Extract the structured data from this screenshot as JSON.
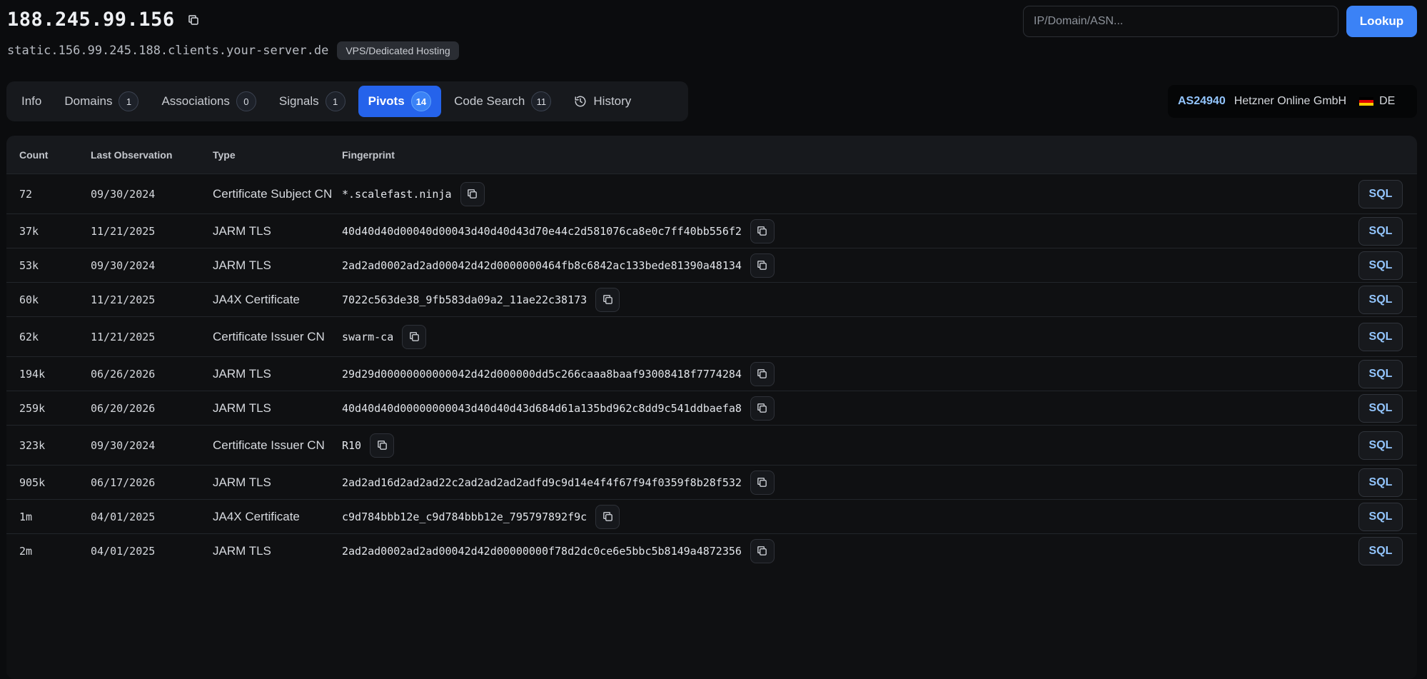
{
  "header": {
    "ip": "188.245.99.156",
    "hostname": "static.156.99.245.188.clients.your-server.de",
    "host_tag": "VPS/Dedicated Hosting"
  },
  "search": {
    "placeholder": "IP/Domain/ASN...",
    "value": "",
    "button_label": "Lookup"
  },
  "tabs": [
    {
      "label": "Info",
      "count": null
    },
    {
      "label": "Domains",
      "count": "1"
    },
    {
      "label": "Associations",
      "count": "0"
    },
    {
      "label": "Signals",
      "count": "1"
    },
    {
      "label": "Pivots",
      "count": "14",
      "active": true
    },
    {
      "label": "Code Search",
      "count": "11"
    },
    {
      "label": "History",
      "icon": "history-icon"
    }
  ],
  "asn_info": {
    "asn": "AS24940",
    "org": "Hetzner Online GmbH",
    "country": "DE",
    "flag_colors": [
      "#000000",
      "#dd0000",
      "#ffce00"
    ]
  },
  "table": {
    "columns": [
      "Count",
      "Last Observation",
      "Type",
      "Fingerprint"
    ],
    "action_label": "SQL",
    "rows": [
      {
        "count": "72",
        "date": "09/30/2024",
        "type": "Certificate Subject CN",
        "fingerprint": "*.scalefast.ninja"
      },
      {
        "count": "37k",
        "date": "11/21/2025",
        "type": "JARM TLS",
        "fingerprint": "40d40d40d00040d00043d40d40d43d70e44c2d581076ca8e0c7ff40bb556f2"
      },
      {
        "count": "53k",
        "date": "09/30/2024",
        "type": "JARM TLS",
        "fingerprint": "2ad2ad0002ad2ad00042d42d0000000464fb8c6842ac133bede81390a48134"
      },
      {
        "count": "60k",
        "date": "11/21/2025",
        "type": "JA4X Certificate",
        "fingerprint": "7022c563de38_9fb583da09a2_11ae22c38173"
      },
      {
        "count": "62k",
        "date": "11/21/2025",
        "type": "Certificate Issuer CN",
        "fingerprint": "swarm-ca"
      },
      {
        "count": "194k",
        "date": "06/26/2026",
        "type": "JARM TLS",
        "fingerprint": "29d29d00000000000042d42d000000dd5c266caaa8baaf93008418f7774284"
      },
      {
        "count": "259k",
        "date": "06/20/2026",
        "type": "JARM TLS",
        "fingerprint": "40d40d40d00000000043d40d40d43d684d61a135bd962c8dd9c541ddbaefa8"
      },
      {
        "count": "323k",
        "date": "09/30/2024",
        "type": "Certificate Issuer CN",
        "fingerprint": "R10"
      },
      {
        "count": "905k",
        "date": "06/17/2026",
        "type": "JARM TLS",
        "fingerprint": "2ad2ad16d2ad2ad22c2ad2ad2ad2adfd9c9d14e4f4f67f94f0359f8b28f532"
      },
      {
        "count": "1m",
        "date": "04/01/2025",
        "type": "JA4X Certificate",
        "fingerprint": "c9d784bbb12e_c9d784bbb12e_795797892f9c"
      },
      {
        "count": "2m",
        "date": "04/01/2025",
        "type": "JARM TLS",
        "fingerprint": "2ad2ad0002ad2ad00042d42d00000000f78d2dc0ce6e5bbc5b8149a4872356"
      }
    ]
  },
  "colors": {
    "accent": "#3b82f6",
    "active_tab": "#2563eb",
    "asn_text": "#93c5fd",
    "background": "#0b0c0e"
  }
}
